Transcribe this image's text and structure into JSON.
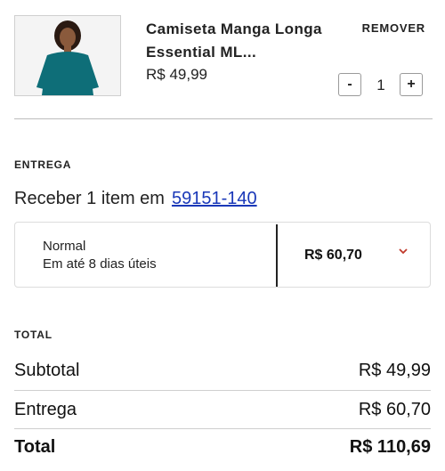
{
  "product": {
    "title": "Camiseta Manga Longa Essential ML...",
    "price": "R$ 49,99",
    "quantity": "1",
    "remove_label": "REMOVER",
    "minus_label": "-",
    "plus_label": "+",
    "image_colors": {
      "shirt": "#0e6e78",
      "skin": "#8a5a3c",
      "hair": "#2a1a12"
    }
  },
  "delivery": {
    "section_title": "ENTREGA",
    "receive_prefix": "Receber 1 item em",
    "zip_code": "59151-140",
    "option": {
      "name": "Normal",
      "eta": "Em até 8 dias úteis",
      "price": "R$ 60,70",
      "chevron_icon": "chevron-down-icon",
      "chevron_color": "#c0392b"
    }
  },
  "totals": {
    "section_title": "TOTAL",
    "rows": [
      {
        "label": "Subtotal",
        "value": "R$ 49,99"
      },
      {
        "label": "Entrega",
        "value": "R$ 60,70"
      },
      {
        "label": "Total",
        "value": "R$ 110,69"
      }
    ]
  },
  "colors": {
    "link": "#1a38b8",
    "divider": "#cfcfcf"
  }
}
